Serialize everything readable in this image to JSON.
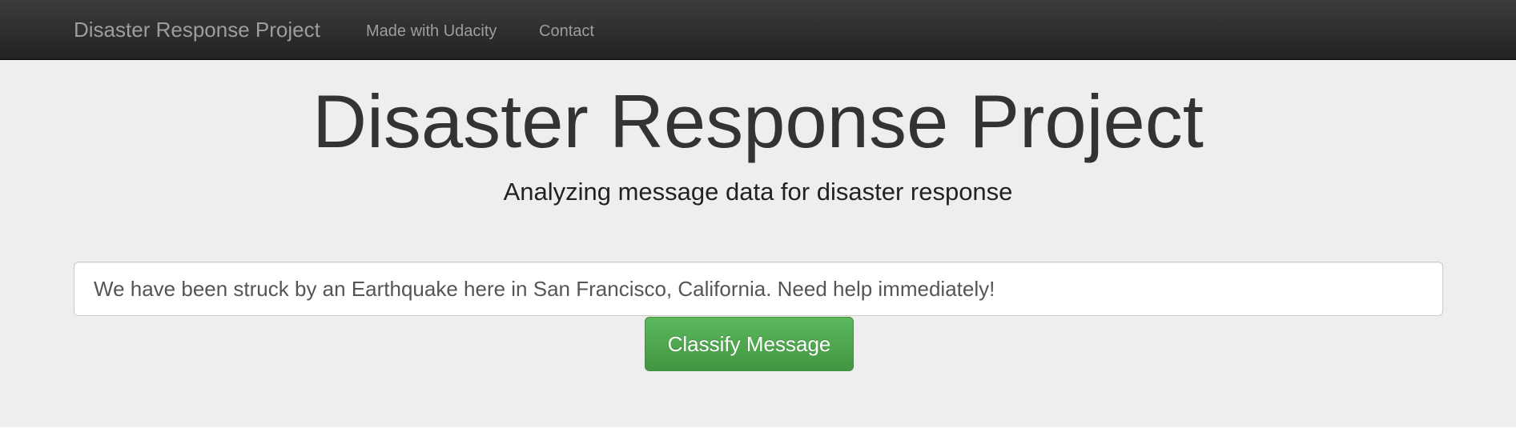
{
  "navbar": {
    "brand": "Disaster Response Project",
    "links": [
      {
        "label": "Made with Udacity"
      },
      {
        "label": "Contact"
      }
    ]
  },
  "main": {
    "title": "Disaster Response Project",
    "subtitle": "Analyzing message data for disaster response",
    "message_input": {
      "value": "We have been struck by an Earthquake here in San Francisco, California. Need help immediately!"
    },
    "classify_button_label": "Classify Message"
  },
  "colors": {
    "navbar_bg": "#222222",
    "nav_text": "#9d9d9d",
    "jumbotron_bg": "#eeeeee",
    "button_green": "#5cb85c"
  }
}
